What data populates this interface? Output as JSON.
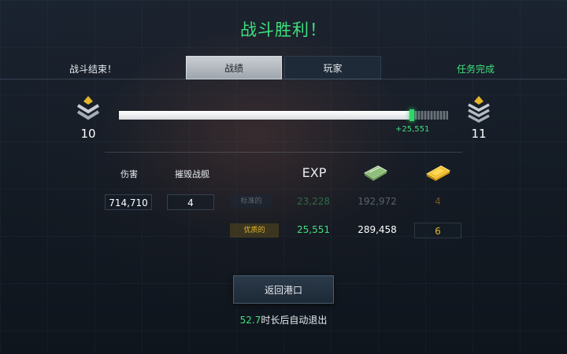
{
  "title": "战斗胜利！",
  "left_status": "战斗结束！",
  "right_status": "任务完成",
  "tabs": [
    {
      "label": "战绩",
      "active": true
    },
    {
      "label": "玩家",
      "active": false
    }
  ],
  "rank": {
    "current": "10",
    "next": "11"
  },
  "xp_progress": {
    "filled_before": 0.86,
    "filled_after": 0.89,
    "gain_text": "+25,551"
  },
  "stats": {
    "damage_label": "伤害",
    "damage_value": "714,710",
    "destroyed_label": "摧毁战舰",
    "destroyed_value": "4"
  },
  "rewards": {
    "exp_label": "EXP",
    "icons": [
      "credits-icon",
      "gold-icon"
    ],
    "standard": {
      "label": "标准的",
      "exp": "23,228",
      "credits": "192,972",
      "gold": "4"
    },
    "premium": {
      "label": "优质的",
      "exp": "25,551",
      "credits": "289,458",
      "gold": "6"
    }
  },
  "return_button": "返回港口",
  "countdown": {
    "seconds": "52.7",
    "text": "时长后自动退出"
  },
  "colors": {
    "accent_green": "#3fe07c",
    "gold": "#e5b52a"
  }
}
